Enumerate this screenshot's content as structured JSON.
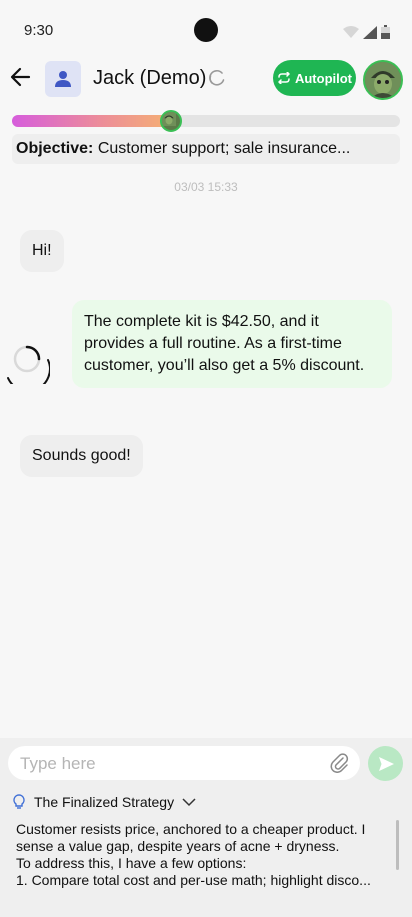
{
  "status_bar": {
    "time": "9:30"
  },
  "header": {
    "contact_name": "Jack (Demo)",
    "autopilot_label": "Autopilot"
  },
  "progress": {
    "fraction": 0.41
  },
  "objective": {
    "label": "Objective:",
    "text": "Customer support; sale insurance..."
  },
  "chat": {
    "timestamp": "03/03 15:33",
    "messages": [
      {
        "direction": "incoming",
        "text": "Hi!"
      },
      {
        "direction": "outgoing",
        "text": "The complete kit is $42.50, and it provides a full routine. As a first-time customer, you’ll also get a 5% discount."
      },
      {
        "direction": "incoming",
        "text": "Sounds good!"
      }
    ]
  },
  "composer": {
    "placeholder": "Type here"
  },
  "strategy": {
    "title": "The Finalized Strategy",
    "lines": [
      "Customer resists price, anchored to a cheaper product. I",
      "sense a value gap, despite years of acne + dryness.",
      "To address this, I have a few options:",
      "1. Compare total cost and per-use math; highlight disco..."
    ]
  },
  "colors": {
    "accent_green": "#1fb653",
    "outgoing_bubble": "#eafaea",
    "incoming_bubble": "#eeeeee"
  },
  "icons": [
    "back-arrow-icon",
    "person-icon",
    "refresh-icon",
    "autopilot-loop-icon",
    "paperclip-icon",
    "send-icon",
    "lightbulb-icon",
    "chevron-down-icon",
    "loading-spinner-icon"
  ]
}
